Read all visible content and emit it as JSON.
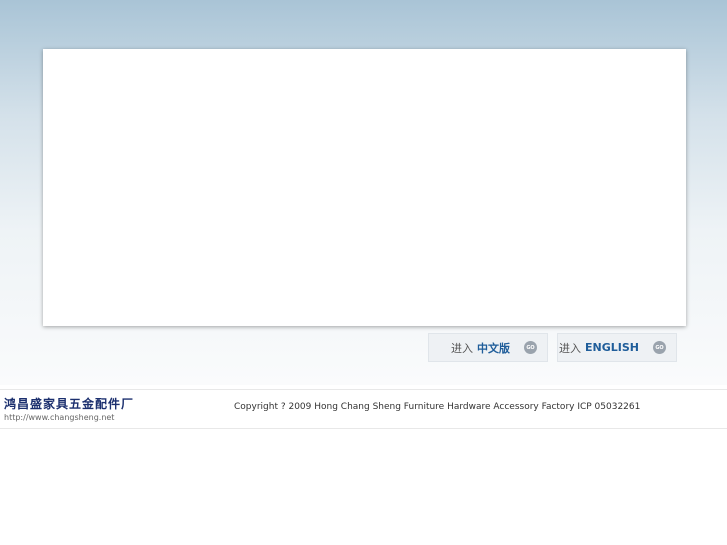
{
  "buttons": [
    {
      "prefix": "进入",
      "label": "中文版",
      "icon": "go-icon",
      "icon_text": "GO"
    },
    {
      "prefix": "进入",
      "label": "ENGLISH",
      "icon": "go-icon",
      "icon_text": "GO"
    }
  ],
  "footer": {
    "logo_name": "鸿昌盛家具五金配件厂",
    "logo_url": "http://www.changsheng.net",
    "copyright": "Copyright ? 2009 Hong Chang Sheng Furniture Hardware Accessory Factory  ICP 05032261"
  }
}
